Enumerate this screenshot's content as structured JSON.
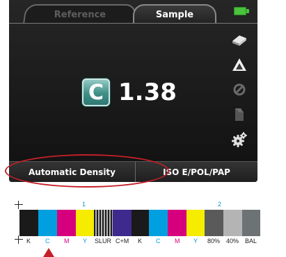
{
  "tabs": {
    "reference": "Reference",
    "sample": "Sample"
  },
  "status": {
    "battery_icon": "battery-full-icon",
    "battery_color": "#49c23d"
  },
  "side_icons": [
    "printer-icon",
    "triangle-icon",
    "no-filter-icon",
    "stack-icon",
    "gear-icon"
  ],
  "reading": {
    "channel": "C",
    "value": "1.38",
    "badge_color": "#3e8f88"
  },
  "softkeys": {
    "left": "Automatic Density",
    "right": "ISO E/POL/PAP"
  },
  "highlight": {
    "color": "#c4202a"
  },
  "control_strip": {
    "groups": [
      "1",
      "2"
    ],
    "patches": [
      {
        "label": "K",
        "color": "#1a1a1a"
      },
      {
        "label": "C",
        "color": "#00a0e0"
      },
      {
        "label": "M",
        "color": "#d6007f"
      },
      {
        "label": "Y",
        "color": "#f5ec00"
      },
      {
        "label": "SLUR",
        "color": "pattern"
      },
      {
        "label": "C+M",
        "color": "#3d2a8c"
      },
      {
        "label": "K",
        "color": "#1a1a1a"
      },
      {
        "label": "C",
        "color": "#00a0e0"
      },
      {
        "label": "M",
        "color": "#d6007f"
      },
      {
        "label": "Y",
        "color": "#f5ec00"
      },
      {
        "label": "80%",
        "color": "#5a5a5a"
      },
      {
        "label": "40%",
        "color": "#b4b4b4"
      },
      {
        "label": "BAL",
        "color": "#6d7275"
      }
    ],
    "selected_patch": "C"
  }
}
